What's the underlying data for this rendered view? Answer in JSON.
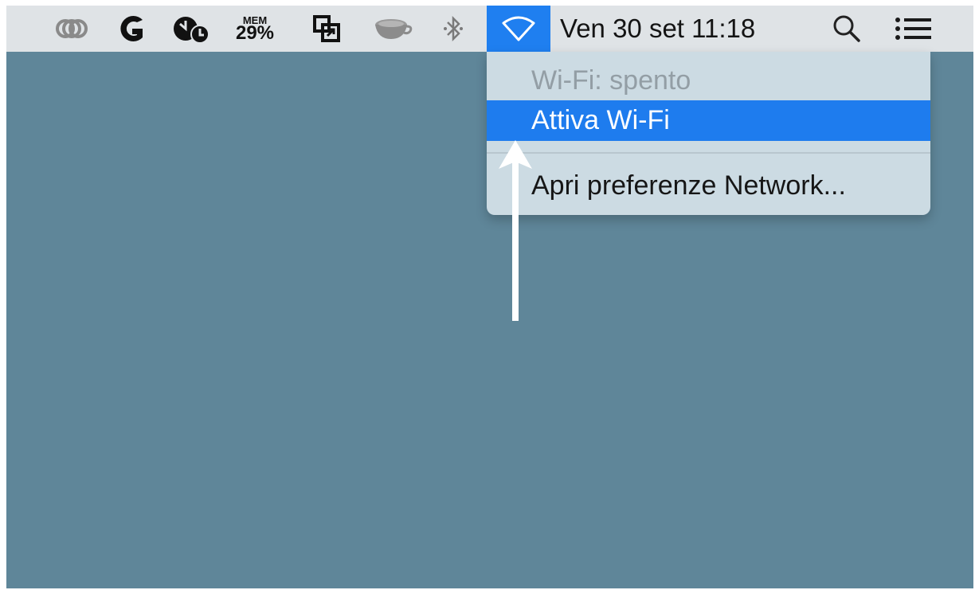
{
  "menubar": {
    "icons": [
      "creative-cloud-icon",
      "logitech-g-icon",
      "time-machine-icon",
      "memory-meter-icon",
      "window-manager-icon",
      "cup-icon",
      "bluetooth-icon",
      "wifi-icon",
      "spotlight-search-icon",
      "notification-center-icon"
    ],
    "memory": {
      "label": "MEM",
      "value": "29%"
    },
    "clock": "Ven 30 set  11:18"
  },
  "wifi_menu": {
    "status": "Wi-Fi: spento",
    "turn_on": "Attiva Wi-Fi",
    "open_prefs": "Apri preferenze Network..."
  },
  "colors": {
    "desktop": "#5f8699",
    "menubar": "#dfe3e6",
    "highlight": "#1e7cee",
    "menu_bg": "#ccdbe3",
    "disabled_text": "#939ea5",
    "annotation_arrow": "#ffffff"
  },
  "annotation": {
    "arrow_icon": "arrow-up-icon"
  }
}
